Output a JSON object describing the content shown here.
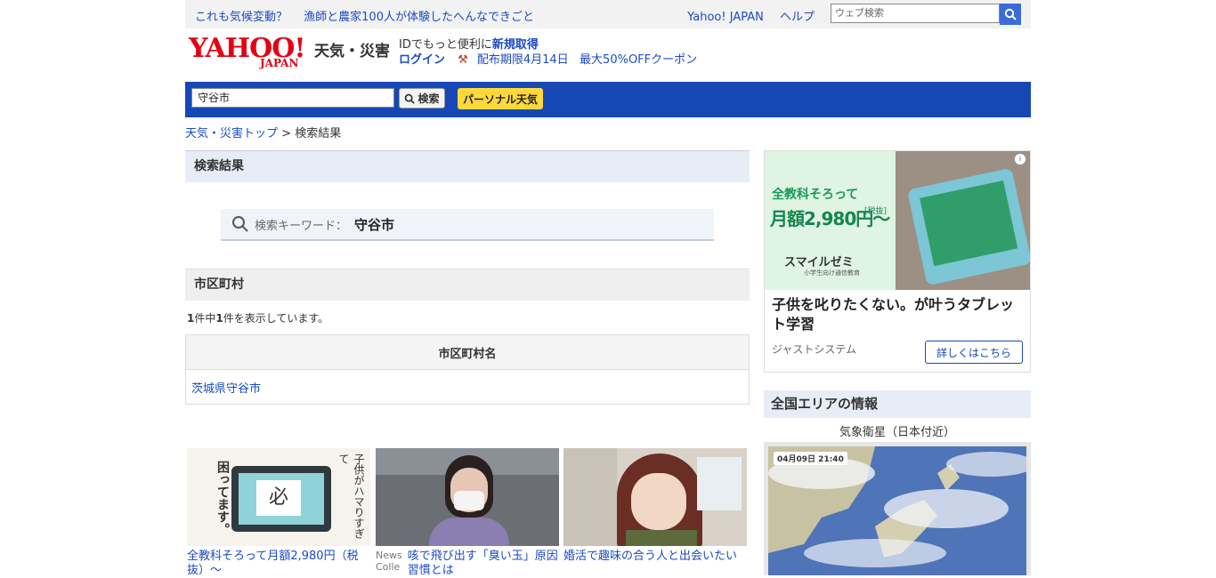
{
  "topbar": {
    "news": [
      "これも気候変動？",
      "漁師と農家100人が体験したへんなできごと"
    ],
    "links": [
      "Yahoo! JAPAN",
      "ヘルプ"
    ],
    "web_search_placeholder": "ウェブ検索"
  },
  "header": {
    "logo_text": "YAHOO!",
    "logo_sub": "JAPAN",
    "service": "天気・災害",
    "promo_line1_prefix": "IDでもっと便利に",
    "promo_register": "新規取得",
    "promo_login": "ログイン",
    "promo_deadline": "配布期限4月14日",
    "promo_coupon": "最大50%OFFクーポン"
  },
  "search": {
    "value": "守谷市",
    "button": "検索",
    "personal": "パーソナル天気"
  },
  "breadcrumb": {
    "home": "天気・災害トップ",
    "sep": ">",
    "current": "検索結果"
  },
  "main": {
    "results_title": "検索結果",
    "keyword_label": "検索キーワード：",
    "keyword": "守谷市",
    "muni_title": "市区町村",
    "count_1": "1",
    "count_mid": "件中",
    "count_2": "1",
    "count_end": "件を表示しています。",
    "table_header": "市区町村名",
    "rows": [
      "茨城県守谷市"
    ]
  },
  "bottom_ads": [
    {
      "caption": "全教科そろって月額2,980円（税抜）〜",
      "image_text": "困ってます。",
      "image_text2": "子供がハマりすぎて"
    },
    {
      "caption": "咳で飛び出す「臭い玉」原因習慣とは",
      "source": "News Colle"
    },
    {
      "caption": "婚活で趣味の合う人と出会いたい"
    }
  ],
  "sidebar": {
    "ad_headline_1": "全教科そろって",
    "ad_price": "月額2,980円〜",
    "ad_tax": "[税抜]",
    "ad_brand": "スマイルゼミ",
    "ad_brand_sub": "小学生向け通信教育",
    "ad_title": "子供を叱りたくない。が叶うタブレット学習",
    "ad_advertiser": "ジャストシステム",
    "ad_more": "詳しくはこちら",
    "area_title": "全国エリアの情報",
    "sat_label": "気象衛星（日本付近）",
    "sat_stamp": "04月09日 21:40"
  },
  "colors": {
    "brand_blue": "#1648b5",
    "yahoo_red": "#e40012",
    "accent_yellow": "#ffd93c"
  }
}
